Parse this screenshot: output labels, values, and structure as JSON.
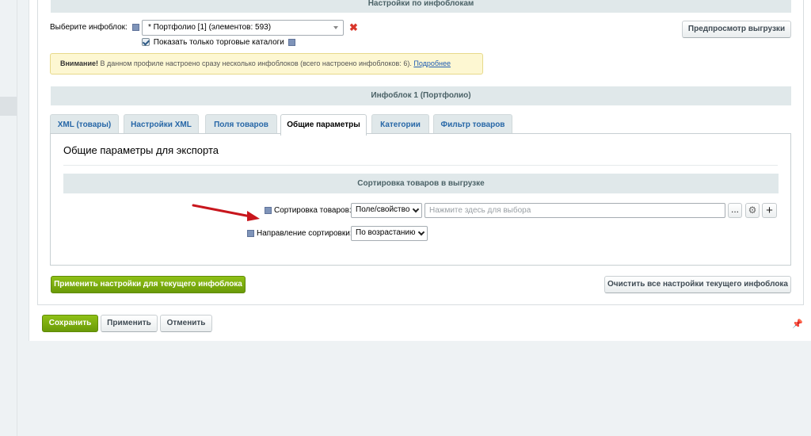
{
  "top_section": {
    "title": "Настройки по инфоблокам"
  },
  "iblock_select": {
    "label": "Выберите инфоблок:",
    "value": "* Портфолио [1] (элементов: 593)",
    "only_catalogs_label": "Показать только торговые каталоги"
  },
  "preview_button": "Предпросмотр выгрузки",
  "warning": {
    "bold": "Внимание!",
    "text": " В данном профиле настроено сразу несколько инфоблоков (всего настроено инфоблоков: 6). ",
    "link": "Подробнее"
  },
  "iblock_section": {
    "title": "Инфоблок 1 (Портфолио)"
  },
  "tabs": [
    {
      "label": "XML (товары)"
    },
    {
      "label": "Настройки XML"
    },
    {
      "label": "Поля товаров"
    },
    {
      "label": "Общие параметры"
    },
    {
      "label": "Категории"
    },
    {
      "label": "Фильтр товаров"
    }
  ],
  "general": {
    "title": "Общие параметры для экспорта",
    "sort_section": "Сортировка товаров в выгрузке",
    "sort_field_label": "Сортировка товаров:",
    "sort_field_type": "Поле/свойство",
    "sort_field_placeholder": "Нажмите здесь для выбора",
    "more_label": "...",
    "plus_label": "+",
    "sort_dir_label": "Направление сортировки:",
    "sort_dir_value": "По возрастанию"
  },
  "apply_iblock_button": "Применить настройки для текущего инфоблока",
  "clear_iblock_button": "Очистить все настройки текущего инфоблока",
  "footer": {
    "save": "Сохранить",
    "apply": "Применить",
    "cancel": "Отменить"
  },
  "colors": {
    "accent_green": "#7cab10",
    "tab_link": "#2767a7",
    "warning_bg": "#fdf7d2",
    "arrow_red": "#c8161d"
  },
  "active_tab_index": 3
}
